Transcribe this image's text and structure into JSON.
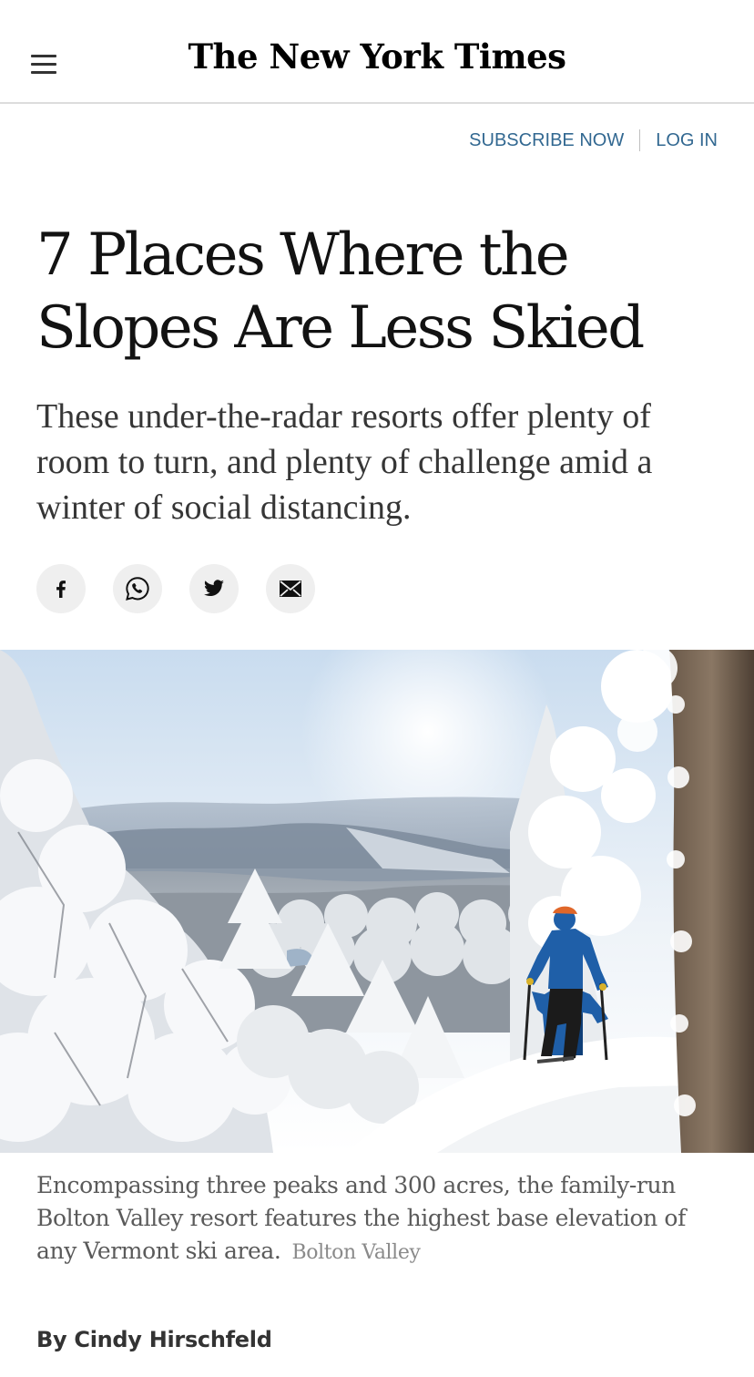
{
  "masthead": {
    "logo_text": "The New York Times"
  },
  "account": {
    "subscribe_label": "SUBSCRIBE NOW",
    "login_label": "LOG IN"
  },
  "article": {
    "headline_line1": "7 Places Where the",
    "headline_line2": "Slopes Are Less Skied",
    "summary": "These under-the-radar resorts offer plenty of room to turn, and plenty of challenge amid a winter of social distancing.",
    "image": {
      "caption": "Encompassing three peaks and 300 acres, the family-run Bolton Valley resort features the highest base elevation of any Vermont ski area.",
      "credit": "Bolton Valley"
    },
    "byline": "By Cindy Hirschfeld"
  },
  "share": {
    "buttons": [
      {
        "icon": "facebook-icon"
      },
      {
        "icon": "whatsapp-icon"
      },
      {
        "icon": "twitter-icon"
      },
      {
        "icon": "email-icon"
      }
    ]
  },
  "colors": {
    "link_blue": "#326891",
    "share_bg": "#efefef",
    "text_dark": "#121212",
    "caption_gray": "#5a5a5a",
    "jacket_blue": "#1f5fa8"
  }
}
